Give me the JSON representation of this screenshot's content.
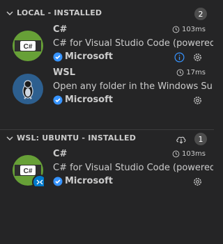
{
  "sections": [
    {
      "title": "LOCAL - INSTALLED",
      "count": "2",
      "extensions": [
        {
          "name": "C#",
          "icon_text": "C#",
          "description": "C# for Visual Studio Code (powered...",
          "publisher": "Microsoft",
          "activation_time": "103ms",
          "has_info": true
        },
        {
          "name": "WSL",
          "icon_text": "",
          "description": "Open any folder in the Windows Su...",
          "publisher": "Microsoft",
          "activation_time": "17ms",
          "has_info": false
        }
      ]
    },
    {
      "title": "WSL: UBUNTU - INSTALLED",
      "count": "1",
      "extensions": [
        {
          "name": "C#",
          "icon_text": "C#",
          "description": "C# for Visual Studio Code (powered...",
          "publisher": "Microsoft",
          "activation_time": "103ms",
          "has_info": false
        }
      ]
    }
  ],
  "colors": {
    "background": "#252526",
    "text": "#cccccc",
    "verified_blue": "#3794ff",
    "csharp_green": "#67a037",
    "wsl_blue": "#2d5f8f",
    "remote_badge": "#007acc"
  },
  "icons": [
    "chevron-down-icon",
    "clock-icon",
    "info-icon",
    "gear-icon",
    "verified-icon",
    "cloud-download-icon",
    "remote-icon",
    "linux-penguin-icon"
  ]
}
